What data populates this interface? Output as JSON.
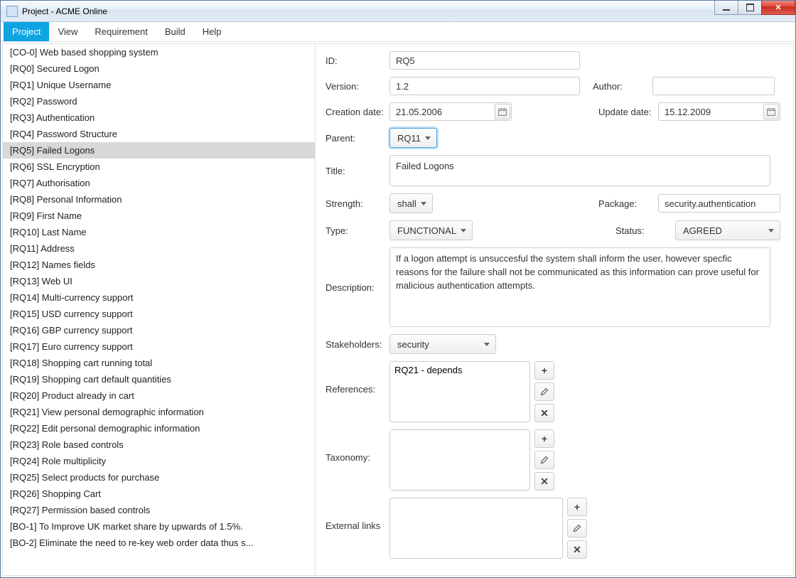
{
  "window": {
    "title": "Project - ACME Online"
  },
  "menu": [
    "Project",
    "View",
    "Requirement",
    "Build",
    "Help"
  ],
  "menu_active_index": 0,
  "sidebar": {
    "selected_index": 6,
    "items": [
      "[CO-0] Web based shopping system",
      "[RQ0] Secured Logon",
      "[RQ1] Unique Username",
      "[RQ2] Password",
      "[RQ3] Authentication",
      "[RQ4] Password Structure",
      "[RQ5] Failed Logons",
      "[RQ6] SSL Encryption",
      "[RQ7] Authorisation",
      "[RQ8] Personal Information",
      "[RQ9] First Name",
      "[RQ10] Last Name",
      "[RQ11] Address",
      "[RQ12] Names fields",
      "[RQ13] Web UI",
      "[RQ14] Multi-currency support",
      "[RQ15] USD currency support",
      "[RQ16] GBP currency support",
      "[RQ17] Euro currency support",
      "[RQ18] Shopping cart running total",
      "[RQ19] Shopping cart default quantities",
      "[RQ20] Product already in cart",
      "[RQ21] View personal demographic information",
      "[RQ22] Edit personal demographic information",
      "[RQ23] Role based controls",
      "[RQ24] Role multiplicity",
      "[RQ25] Select products for purchase",
      "[RQ26] Shopping Cart",
      "[RQ27] Permission based controls",
      "[BO-1] To Improve UK market share by upwards of 1.5%.",
      "[BO-2] Eliminate the need to re-key web order data thus s..."
    ]
  },
  "labels": {
    "id": "ID:",
    "version": "Version:",
    "author": "Author:",
    "creation_date": "Creation date:",
    "update_date": "Update date:",
    "parent": "Parent:",
    "title": "Title:",
    "strength": "Strength:",
    "package": "Package:",
    "type": "Type:",
    "status": "Status:",
    "description": "Description:",
    "stakeholders": "Stakeholders:",
    "references": "References:",
    "taxonomy": "Taxonomy:",
    "external_links": "External links"
  },
  "detail": {
    "id": "RQ5",
    "version": "1.2",
    "author": "",
    "creation_date": "21.05.2006",
    "update_date": "15.12.2009",
    "parent": "RQ11",
    "title": "Failed Logons",
    "strength": "shall",
    "package": "security.authentication",
    "type": "FUNCTIONAL",
    "status": "AGREED",
    "description": "If a logon attempt is unsuccesful the system shall inform the user, however specfic reasons for the failure shall not be communicated as this information can prove useful for malicious authentication attempts.",
    "stakeholders": "security",
    "references": [
      "RQ21 - depends"
    ],
    "taxonomy": [],
    "external_links": []
  }
}
